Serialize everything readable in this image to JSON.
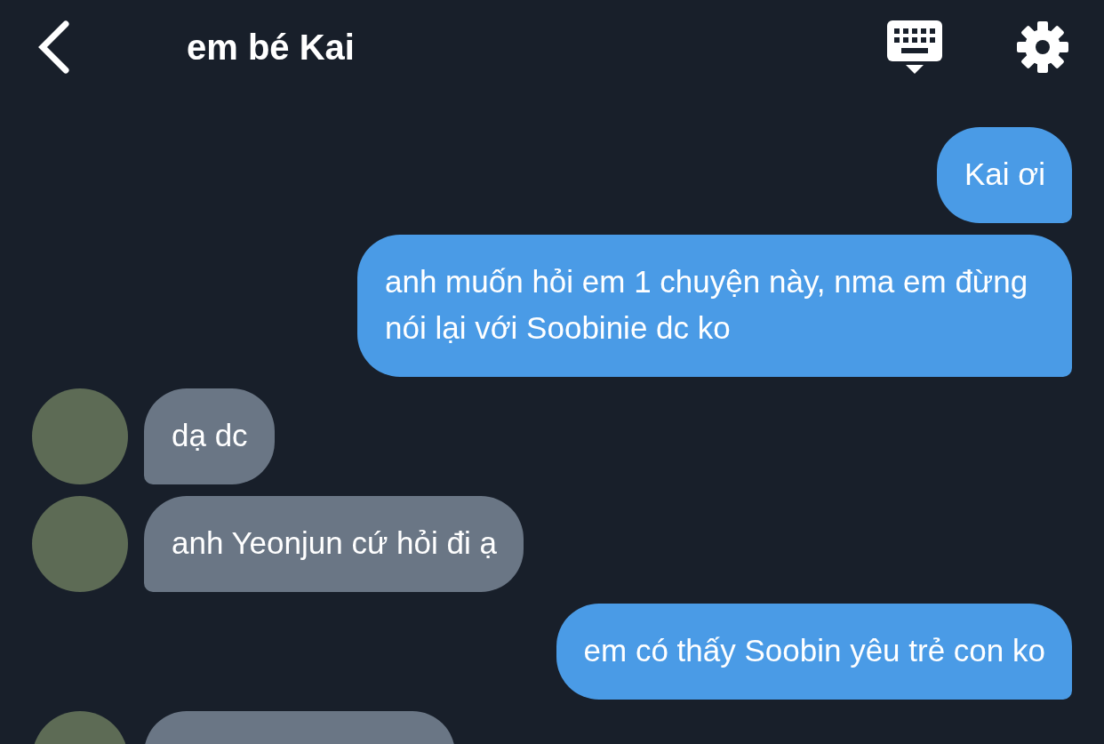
{
  "header": {
    "title": "em bé Kai"
  },
  "messages": [
    {
      "kind": "outgoing",
      "text": "Kai ơi"
    },
    {
      "kind": "outgoing",
      "text": "anh muốn hỏi em 1 chuyện này, nma em đừng nói lại với Soobinie dc ko"
    },
    {
      "kind": "incoming",
      "text": "dạ dc"
    },
    {
      "kind": "incoming",
      "text": "anh Yeonjun cứ hỏi đi ạ"
    },
    {
      "kind": "outgoing",
      "text": "em có thấy Soobin yêu trẻ con ko"
    },
    {
      "kind": "incoming"
    }
  ]
}
